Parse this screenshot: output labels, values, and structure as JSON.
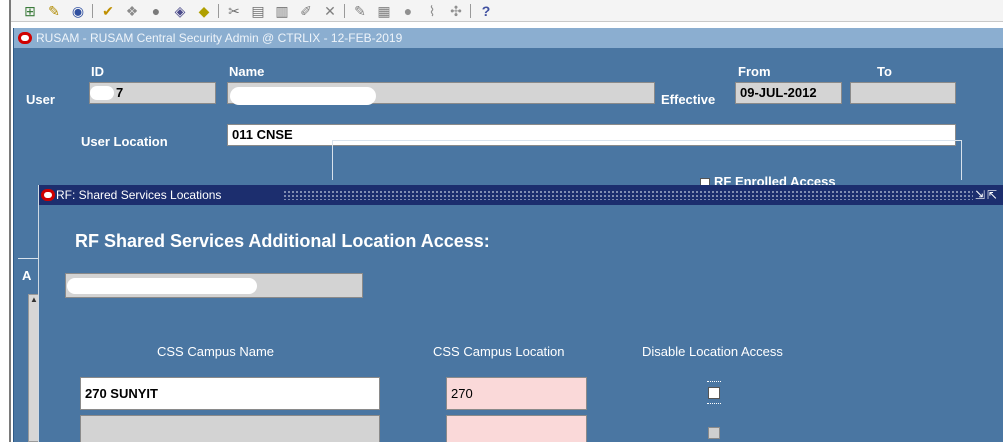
{
  "window": {
    "title": "RUSAM - RUSAM Central Security Admin @ CTRLIX - 12-FEB-2019"
  },
  "toolbar": {
    "icons": [
      "new-icon",
      "find-icon",
      "zoom-icon",
      "check-icon",
      "edit-icon",
      "delete-icon",
      "attach-icon",
      "folder-icon",
      "cut-icon",
      "copy-icon",
      "paste-icon",
      "clear-icon",
      "help-icon"
    ]
  },
  "user": {
    "row_label": "User",
    "id_header": "ID",
    "name_header": "Name",
    "id_value": "7",
    "effective_label": "Effective",
    "from_header": "From",
    "to_header": "To",
    "from_value": "09-JUL-2012",
    "to_value": "",
    "location_label": "User Location",
    "location_value": "011 CNSE"
  },
  "background_panel": {
    "checkbox_label": "RF Enrolled Access"
  },
  "dialog": {
    "title": "RF: Shared Services Locations",
    "heading": "RF Shared Services Additional Location Access:",
    "columns": {
      "campus_name": "CSS Campus Name",
      "campus_location": "CSS Campus Location",
      "disable_access": "Disable Location Access"
    },
    "rows": [
      {
        "campus_name": "270 SUNYIT",
        "campus_location": "270",
        "disabled": false
      },
      {
        "campus_name": "",
        "campus_location": "",
        "disabled": false
      }
    ]
  },
  "colors": {
    "form_bg": "#4a76a2",
    "title_inactive": "#8baed0",
    "dialog_title": "#1c2e6e",
    "required_field": "#fad9d9"
  }
}
